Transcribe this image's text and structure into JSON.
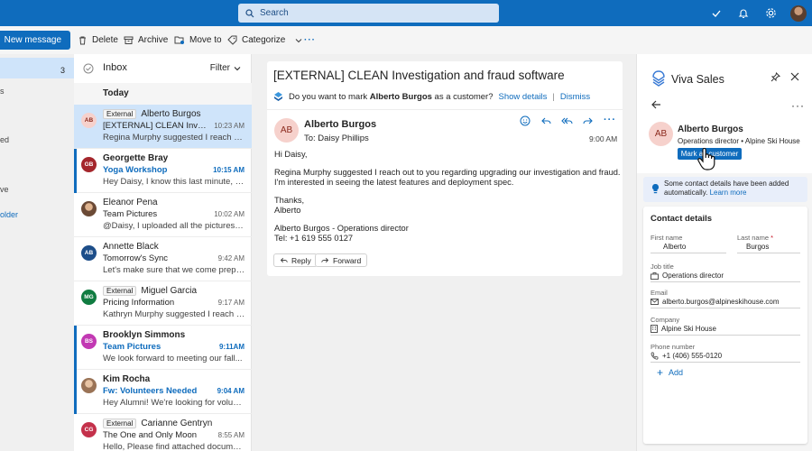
{
  "header": {
    "search_placeholder": "Search"
  },
  "commands": {
    "new_message": "New message",
    "delete": "Delete",
    "archive": "Archive",
    "move_to": "Move to",
    "categorize": "Categorize"
  },
  "leftnav": {
    "inbox_count": "3",
    "fragments": [
      "s",
      "ed",
      "ve",
      "older"
    ]
  },
  "list": {
    "title": "Inbox",
    "filter": "Filter",
    "group": "Today",
    "items": [
      {
        "initials": "AB",
        "color": "#f6d1cc",
        "text_color": "#8b2a1d",
        "sender": "Alberto Burgos",
        "external": "External",
        "subject": "[EXTERNAL] CLEAN Investiga...",
        "time": "10:23 AM",
        "preview": "Regina Murphy suggested I reach out to you"
      },
      {
        "initials": "GB",
        "color": "#a4262c",
        "sender": "Georgette Bray",
        "subject": "Yoga Workshop",
        "time": "10:15 AM",
        "preview": "Hey Daisy, I know this last minute, but..."
      },
      {
        "initials": "EP",
        "color": "#8a6a4f",
        "sender": "Eleanor Pena",
        "subject": "Team Pictures",
        "time": "10:02 AM",
        "preview": "@Daisy, I uploaded all the pictures from..."
      },
      {
        "initials": "AB",
        "color": "#1d4e89",
        "sender": "Annette Black",
        "subject": "Tomorrow's Sync",
        "time": "9:42 AM",
        "preview": "Let's make sure that we come prepared..."
      },
      {
        "initials": "MG",
        "color": "#107c41",
        "sender": "Miguel Garcia",
        "external": "External",
        "subject": "Pricing Information",
        "time": "9:17 AM",
        "preview": "Kathryn Murphy suggested I reach out..."
      },
      {
        "initials": "BS",
        "color": "#c239b3",
        "sender": "Brooklyn Simmons",
        "subject": "Team Pictures",
        "time": "9:11AM",
        "preview": "We look forward to meeting our fall..."
      },
      {
        "initials": "KR",
        "color": "#b08c6a",
        "sender": "Kim Rocha",
        "subject": "Fw: Volunteers Needed",
        "time": "9:04 AM",
        "preview": "Hey Alumni! We're looking for volunteers..."
      },
      {
        "initials": "CG",
        "color": "#c4314b",
        "sender": "Carianne Gentryn",
        "external": "External",
        "subject": "The One and Only Moon",
        "time": "8:55 AM",
        "preview": "Hello, Please find attached document f..."
      }
    ]
  },
  "reading": {
    "subject": "[EXTERNAL] CLEAN Investigation and fraud software",
    "ask_prefix": "Do you want to mark",
    "ask_name": "Alberto Burgos",
    "ask_suffix": "as a customer?",
    "show_details": "Show details",
    "separator": "|",
    "dismiss": "Dismiss",
    "initials": "AB",
    "from": "Alberto Burgos",
    "to": "To: Daisy Phillips",
    "time": "9:00 AM",
    "greeting": "Hi Daisy,",
    "body1": "Regina Murphy suggested I reach out to you regarding upgrading our investigation and fraud.",
    "body2": "I'm interested in seeing the latest features and deployment spec.",
    "thanks": "Thanks,",
    "sign": "Alberto",
    "sig1": "Alberto Burgos - Operations director",
    "sig2": "Tel: +1 619 555 0127",
    "reply": "Reply",
    "forward": "Forward"
  },
  "viva": {
    "title": "Viva Sales",
    "initials": "AB",
    "name": "Alberto Burgos",
    "role": "Operations director • Alpine Ski House",
    "mark": "Mark as customer",
    "info1": "Some contact details have been added",
    "info2": "automatically.",
    "learn_more": "Learn more",
    "card_title": "Contact details",
    "first_name_label": "First name",
    "first_name": "Alberto",
    "last_name_label": "Last name",
    "required": "*",
    "last_name": "Burgos",
    "job_label": "Job title",
    "job": "Operations director",
    "email_label": "Email",
    "email": "alberto.burgos@alpineskihouse.com",
    "company_label": "Company",
    "company": "Alpine Ski House",
    "phone_label": "Phone number",
    "phone": "+1 (406) 555-0120",
    "add": "Add"
  }
}
